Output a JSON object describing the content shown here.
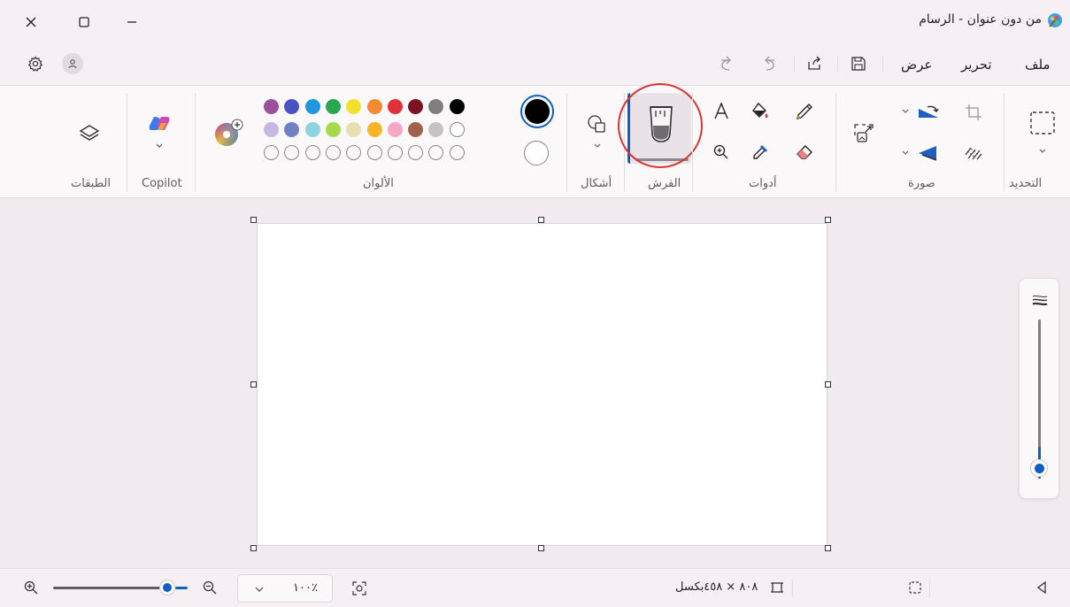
{
  "window": {
    "title": "من دون عنوان - الرسام"
  },
  "menu": {
    "file": "ملف",
    "edit": "تحرير",
    "view": "عرض"
  },
  "ribbon": {
    "selection_label": "التحديد",
    "image_label": "صورة",
    "tools_label": "أدوات",
    "brushes_label": "الفرش",
    "shapes_label": "أشكال",
    "colors_label": "الألوان",
    "copilot_label": "Copilot",
    "layers_label": "الطبقات"
  },
  "palette": {
    "row1": [
      "#9c4f9d",
      "#4b53c2",
      "#1f97df",
      "#2aa652",
      "#f2e12c",
      "#f28a32",
      "#e2313b",
      "#7a1422",
      "#7e7e7e",
      "#000000"
    ],
    "row2": [
      "#c7b8e2",
      "#7381c3",
      "#8ed4df",
      "#a6d94c",
      "#e9dfae",
      "#f5b526",
      "#f5a7c5",
      "#a0624a",
      "#c3c3c3",
      "#ffffff"
    ],
    "row3_count": 10,
    "primary": "#000000",
    "secondary": "#ffffff"
  },
  "status": {
    "canvas_size": "٨٠٨ × ٤٥٨بكسل",
    "zoom": "١٠٠٪",
    "zoom_slider": 0.85
  },
  "colors": {
    "accent": "#0f5fc0",
    "highlight_ring": "#d93535"
  }
}
